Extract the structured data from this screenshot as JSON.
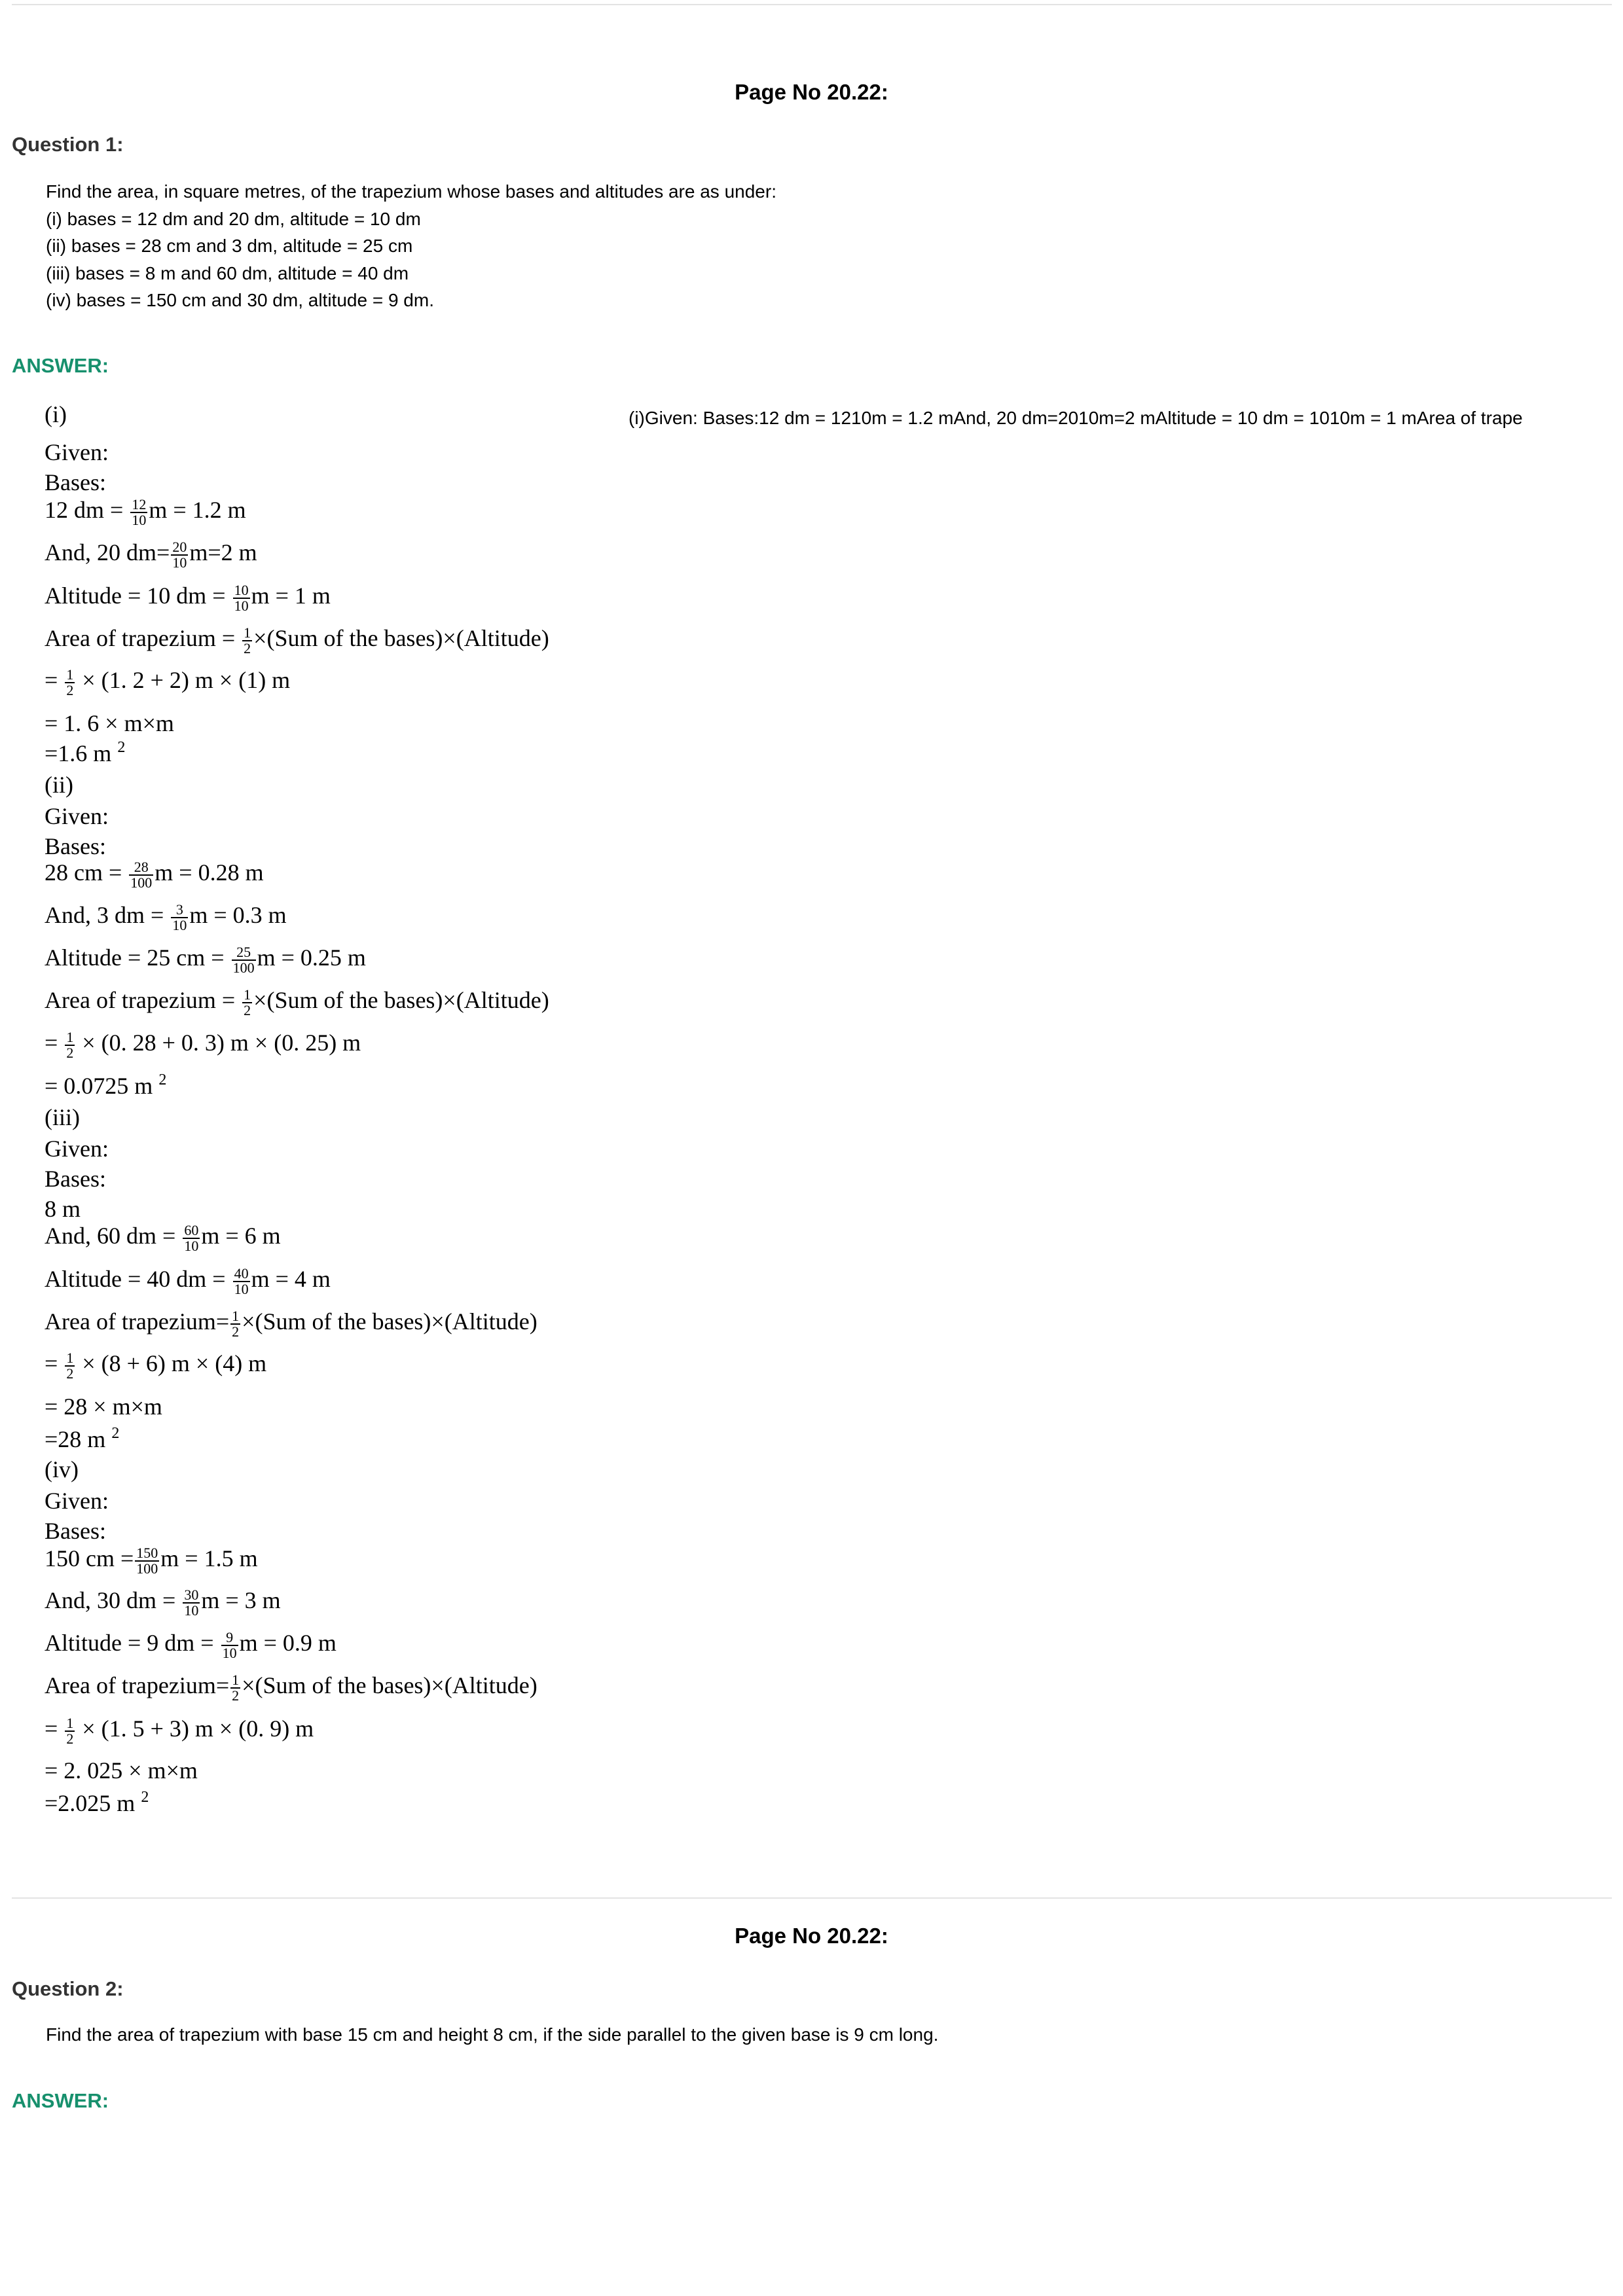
{
  "page_label": "Page No 20.22:",
  "q1": {
    "heading": "Question 1:",
    "intro": "Find the area, in square metres, of the trapezium whose bases and altitudes are as under:",
    "items": [
      "(i) bases = 12 dm and 20 dm, altitude = 10 dm",
      "(ii) bases = 28 cm and 3 dm, altitude = 25 cm",
      "(iii) bases = 8 m and 60 dm, altitude = 40 dm",
      "(iv) bases = 150 cm and 30 dm, altitude = 9 dm."
    ]
  },
  "answer_heading": "ANSWER:",
  "alt_text": "(i)Given: Bases:12 dm = 1210m = 1.2 mAnd, 20 dm=2010m=2 mAltitude = 10 dm = 1010m = 1 mArea of trape",
  "solution": {
    "given": "Given:",
    "bases": "Bases:",
    "part1": {
      "label": "(i)",
      "b1_pre": "12 dm = ",
      "b1_num": "12",
      "b1_den": "10",
      "b1_post": "m = 1.2 m",
      "b2_pre": "And, 20 dm=",
      "b2_num": "20",
      "b2_den": "10",
      "b2_post": "m=2 m",
      "alt_pre": "Altitude = 10 dm = ",
      "alt_num": "10",
      "alt_den": "10",
      "alt_post": "m = 1 m",
      "area_pre": "Area of trapezium = ",
      "half_num": "1",
      "half_den": "2",
      "area_post": "×(Sum of the bases)×(Altitude)",
      "calc_pre": "= ",
      "calc_post": " × (1. 2 + 2) m × (1) m",
      "step": "= 1. 6 × m×m",
      "result": "=1.6 m",
      "exp": "2"
    },
    "part2": {
      "label": "(ii)",
      "b1_pre": "28 cm = ",
      "b1_num": "28",
      "b1_den": "100",
      "b1_post": "m = 0.28 m",
      "b2_pre": "And, 3 dm = ",
      "b2_num": "3",
      "b2_den": "10",
      "b2_post": "m = 0.3 m",
      "alt_pre": "Altitude = 25 cm = ",
      "alt_num": "25",
      "alt_den": "100",
      "alt_post": "m = 0.25 m",
      "area_pre": "Area of trapezium = ",
      "half_num": "1",
      "half_den": "2",
      "area_post": "×(Sum of the bases)×(Altitude)",
      "calc_pre": "= ",
      "calc_post": " × (0. 28 + 0. 3) m × (0. 25) m",
      "result": "= 0.0725 m",
      "exp": "2"
    },
    "part3": {
      "label": "(iii)",
      "b1": "8 m",
      "b2_pre": "And, 60 dm = ",
      "b2_num": "60",
      "b2_den": "10",
      "b2_post": "m = 6 m",
      "alt_pre": "Altitude = 40 dm = ",
      "alt_num": "40",
      "alt_den": "10",
      "alt_post": "m = 4 m",
      "area_pre": "Area of trapezium=",
      "half_num": "1",
      "half_den": "2",
      "area_post": "×(Sum of the bases)×(Altitude)",
      "calc_pre": "= ",
      "calc_post": " × (8 + 6) m × (4) m",
      "step": "= 28 × m×m",
      "result": "=28 m",
      "exp": "2"
    },
    "part4": {
      "label": "(iv)",
      "b1_pre": "150 cm =",
      "b1_num": "150",
      "b1_den": "100",
      "b1_post": "m = 1.5 m",
      "b2_pre": "And, 30 dm = ",
      "b2_num": "30",
      "b2_den": "10",
      "b2_post": "m = 3 m",
      "alt_pre": "Altitude = 9 dm = ",
      "alt_num": "9",
      "alt_den": "10",
      "alt_post": "m = 0.9 m",
      "area_pre": "Area of trapezium=",
      "half_num": "1",
      "half_den": "2",
      "area_post": "×(Sum of the bases)×(Altitude)",
      "calc_pre": "= ",
      "calc_post": " × (1. 5 + 3) m × (0. 9) m",
      "step": "= 2. 025 × m×m",
      "result": "=2.025 m",
      "exp": "2"
    }
  },
  "q2": {
    "heading": "Question 2:",
    "text": "Find the area of trapezium with base 15 cm and height 8 cm, if the side parallel to the given base is 9 cm long."
  }
}
